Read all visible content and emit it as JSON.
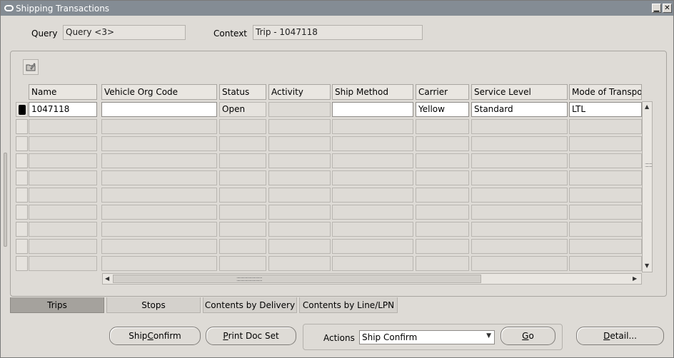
{
  "window": {
    "title": "Shipping Transactions"
  },
  "header": {
    "query_label": "Query",
    "query_value": "Query <3>",
    "context_label": "Context",
    "context_value": "Trip - 1047118"
  },
  "table": {
    "columns": [
      "Name",
      "Vehicle Org Code",
      "Status",
      "Activity",
      "Ship Method",
      "Carrier",
      "Service Level",
      "Mode of Transpor"
    ],
    "rows": [
      [
        "1047118",
        "",
        "Open",
        "",
        "",
        "Yellow",
        "Standard",
        "LTL"
      ]
    ],
    "empty_rows": 9
  },
  "tabs": [
    {
      "label": "Trips",
      "active": true
    },
    {
      "label": "Stops",
      "active": false
    },
    {
      "label": "Contents by Delivery",
      "active": false
    },
    {
      "label": "Contents by Line/LPN",
      "active": false
    }
  ],
  "buttons": {
    "ship_confirm_a": "Ship ",
    "ship_confirm_b": "C",
    "ship_confirm_c": "onfirm",
    "print_doc_set_a": "",
    "print_doc_set_b": "P",
    "print_doc_set_c": "rint Doc Set",
    "go_a": "",
    "go_b": "G",
    "go_c": "o",
    "detail_a": "",
    "detail_b": "D",
    "detail_c": "etail..."
  },
  "actions": {
    "label": "Actions",
    "selected": "Ship Confirm"
  },
  "colors": {
    "titlebar": "#848c94",
    "window_bg": "#dedbd6",
    "active_tab": "#a5a29d"
  }
}
